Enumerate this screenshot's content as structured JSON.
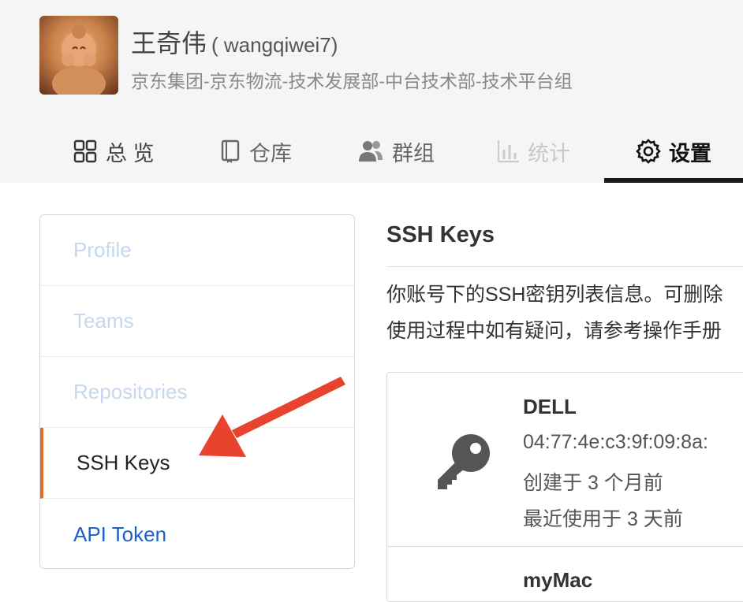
{
  "user": {
    "name": "王奇伟",
    "handle": "( wangqiwei7)",
    "org": "京东集团-京东物流-技术发展部-中台技术部-技术平台组"
  },
  "tabs": [
    {
      "label": "总 览",
      "icon": "grid-icon"
    },
    {
      "label": "仓库",
      "icon": "book-icon"
    },
    {
      "label": "群组",
      "icon": "people-icon"
    },
    {
      "label": "统计",
      "icon": "bar-chart-icon"
    },
    {
      "label": "设置",
      "icon": "gear-icon",
      "active": true
    }
  ],
  "side_menu": {
    "items": [
      {
        "label": "Profile"
      },
      {
        "label": "Teams"
      },
      {
        "label": "Repositories"
      },
      {
        "label": "SSH Keys",
        "active": true
      },
      {
        "label": "API Token"
      }
    ]
  },
  "main": {
    "title": "SSH Keys",
    "desc_line1": "你账号下的SSH密钥列表信息。可删除",
    "desc_line2": "使用过程中如有疑问，请参考操作手册"
  },
  "keys": [
    {
      "name": "DELL",
      "fingerprint": "04:77:4e:c3:9f:09:8a:",
      "created": "创建于 3 个月前",
      "last_used": "最近使用于 3 天前"
    },
    {
      "name": "myMac"
    }
  ],
  "colors": {
    "header_bg": "#f5f5f5",
    "active_marker": "#e3692d",
    "link": "#1e5fc8",
    "arrow": "#e8432d"
  }
}
